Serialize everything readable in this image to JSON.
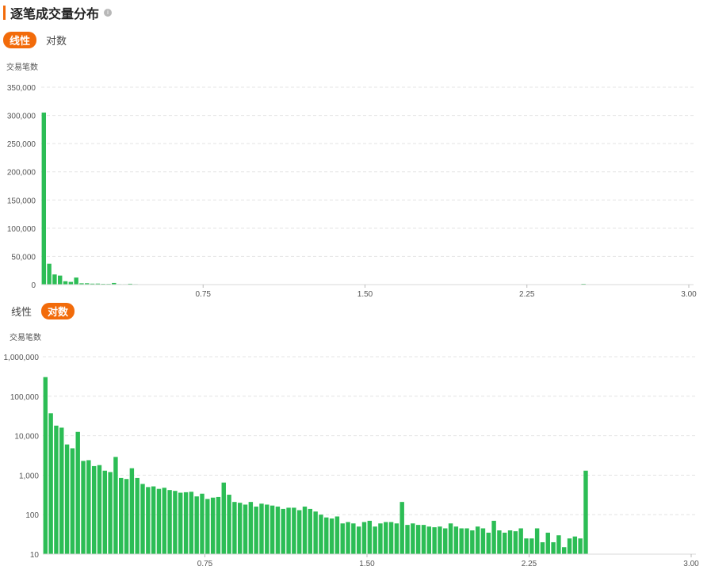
{
  "header": {
    "title": "逐笔成交量分布",
    "info_icon": "info-icon"
  },
  "colors": {
    "accent": "#f26b0a",
    "bar": "#2cbd55",
    "grid": "#e4e4e4",
    "axis_text": "#555555"
  },
  "top_toggle": {
    "linear_label": "线性",
    "log_label": "对数",
    "active": "linear"
  },
  "bottom_toggle": {
    "linear_label": "线性",
    "log_label": "对数",
    "active": "log"
  },
  "chart_data": [
    {
      "type": "bar",
      "scale": "linear",
      "ylabel": "交易笔数",
      "ylim": [
        0,
        350000
      ],
      "yticks": [
        "0",
        "50,000",
        "100,000",
        "150,000",
        "200,000",
        "250,000",
        "300,000",
        "350,000"
      ],
      "xlim": [
        0,
        3.0
      ],
      "xticks": [
        "0.75",
        "1.50",
        "2.25",
        "3.00"
      ],
      "grid": true,
      "bin_width": 0.025,
      "values": [
        305000,
        37000,
        18000,
        16000,
        6000,
        4800,
        12500,
        2300,
        2400,
        1700,
        1800,
        1300,
        1200,
        2900,
        850,
        800,
        1500,
        850,
        600,
        500,
        520,
        450,
        480,
        420,
        400,
        360,
        370,
        380,
        290,
        340,
        250,
        270,
        280,
        650,
        320,
        210,
        200,
        180,
        210,
        160,
        190,
        180,
        170,
        160,
        140,
        150,
        150,
        130,
        160,
        140,
        120,
        100,
        85,
        80,
        90,
        60,
        65,
        60,
        50,
        65,
        70,
        50,
        60,
        65,
        65,
        60,
        210,
        55,
        60,
        55,
        55,
        50,
        48,
        50,
        45,
        60,
        50,
        45,
        45,
        40,
        50,
        45,
        35,
        70,
        40,
        35,
        40,
        38,
        45,
        25,
        25,
        45,
        20,
        35,
        20,
        30,
        15,
        25,
        28,
        25,
        1300
      ]
    },
    {
      "type": "bar",
      "scale": "log",
      "ylabel": "交易笔数",
      "ylim": [
        10,
        1000000
      ],
      "yticks": [
        "10",
        "100",
        "1,000",
        "10,000",
        "100,000",
        "1,000,000"
      ],
      "xlim": [
        0,
        3.0
      ],
      "xticks": [
        "0.75",
        "1.50",
        "2.25",
        "3.00"
      ],
      "grid": true,
      "bin_width": 0.025,
      "values": [
        305000,
        37000,
        18000,
        16000,
        6000,
        4800,
        12500,
        2300,
        2400,
        1700,
        1800,
        1300,
        1200,
        2900,
        850,
        800,
        1500,
        850,
        600,
        500,
        520,
        450,
        480,
        420,
        400,
        360,
        370,
        380,
        290,
        340,
        250,
        270,
        280,
        650,
        320,
        210,
        200,
        180,
        210,
        160,
        190,
        180,
        170,
        160,
        140,
        150,
        150,
        130,
        160,
        140,
        120,
        100,
        85,
        80,
        90,
        60,
        65,
        60,
        50,
        65,
        70,
        50,
        60,
        65,
        65,
        60,
        210,
        55,
        60,
        55,
        55,
        50,
        48,
        50,
        45,
        60,
        50,
        45,
        45,
        40,
        50,
        45,
        35,
        70,
        40,
        35,
        40,
        38,
        45,
        25,
        25,
        45,
        20,
        35,
        20,
        30,
        15,
        25,
        28,
        25,
        1300
      ]
    }
  ]
}
